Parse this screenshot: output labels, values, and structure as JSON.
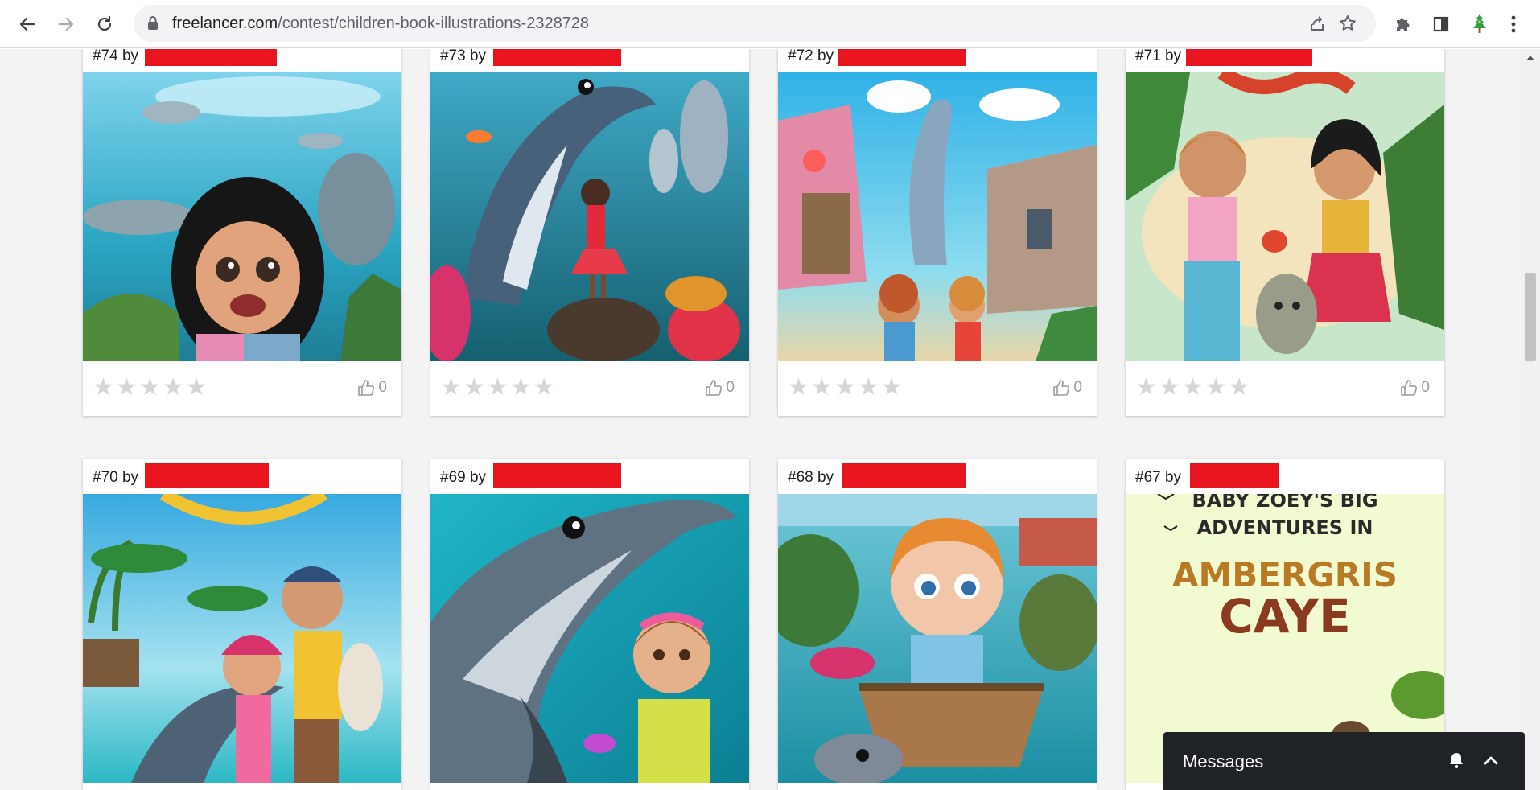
{
  "browser": {
    "url_host": "freelancer.com",
    "url_path": "/contest/children-book-illustrations-2328728",
    "icons": [
      "back-icon",
      "forward-icon",
      "reload-icon",
      "lock-icon",
      "share-icon",
      "bookmark-star-icon",
      "extensions-puzzle-icon",
      "side-panel-icon",
      "tree-extension-icon",
      "menu-kebab-icon"
    ]
  },
  "entries": [
    {
      "label": "#74 by",
      "rating": 0,
      "likes": "0",
      "thumb": "girl-with-dolphins"
    },
    {
      "label": "#73 by",
      "rating": 0,
      "likes": "0",
      "thumb": "girl-and-dolphin-underwater"
    },
    {
      "label": "#72 by",
      "rating": 0,
      "likes": "0",
      "thumb": "children-dolphin-houses"
    },
    {
      "label": "#71 by",
      "rating": 0,
      "likes": "0",
      "thumb": "two-girls-beach-turtle"
    },
    {
      "label": "#70 by",
      "rating": 0,
      "likes": "0",
      "thumb": "kids-beach-dolphin"
    },
    {
      "label": "#69 by",
      "rating": 0,
      "likes": "0",
      "thumb": "dolphin-closeup-girl"
    },
    {
      "label": "#68 by",
      "rating": 0,
      "likes": "0",
      "thumb": "baby-in-basket-boat"
    },
    {
      "label": "#67 by",
      "rating": 0,
      "likes": "",
      "thumb": "book-cover"
    }
  ],
  "cover": {
    "line1": "BABY ZOEY'S BIG",
    "line2": "ADVENTURES IN",
    "line3": "AMBERGRIS",
    "line4": "CAYE"
  },
  "messages": {
    "label": "Messages",
    "icons": [
      "bell-icon",
      "chevron-up-icon"
    ]
  },
  "colors": {
    "redaction": "#e8141e",
    "messages_bar": "#1f2227",
    "star_empty": "#d6d6d6"
  }
}
